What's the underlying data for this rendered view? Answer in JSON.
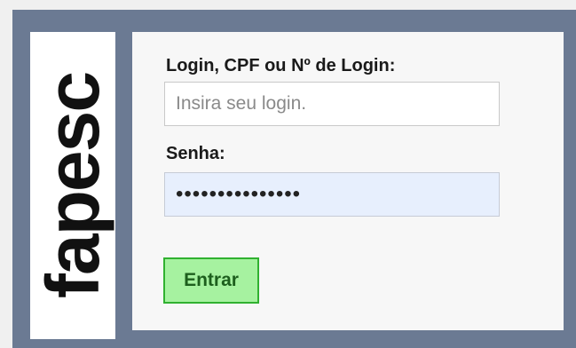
{
  "logo": {
    "text": "fapesc"
  },
  "login": {
    "label": "Login, CPF ou Nº de Login:",
    "placeholder": "Insira seu login.",
    "value": ""
  },
  "password": {
    "label": "Senha:",
    "value": "•••••••••••••••"
  },
  "submit": {
    "label": "Entrar"
  },
  "colors": {
    "panel": "#6b7a93",
    "button_bg": "#a6f2a0",
    "button_border": "#30b130",
    "password_field_bg": "#e7effd"
  }
}
